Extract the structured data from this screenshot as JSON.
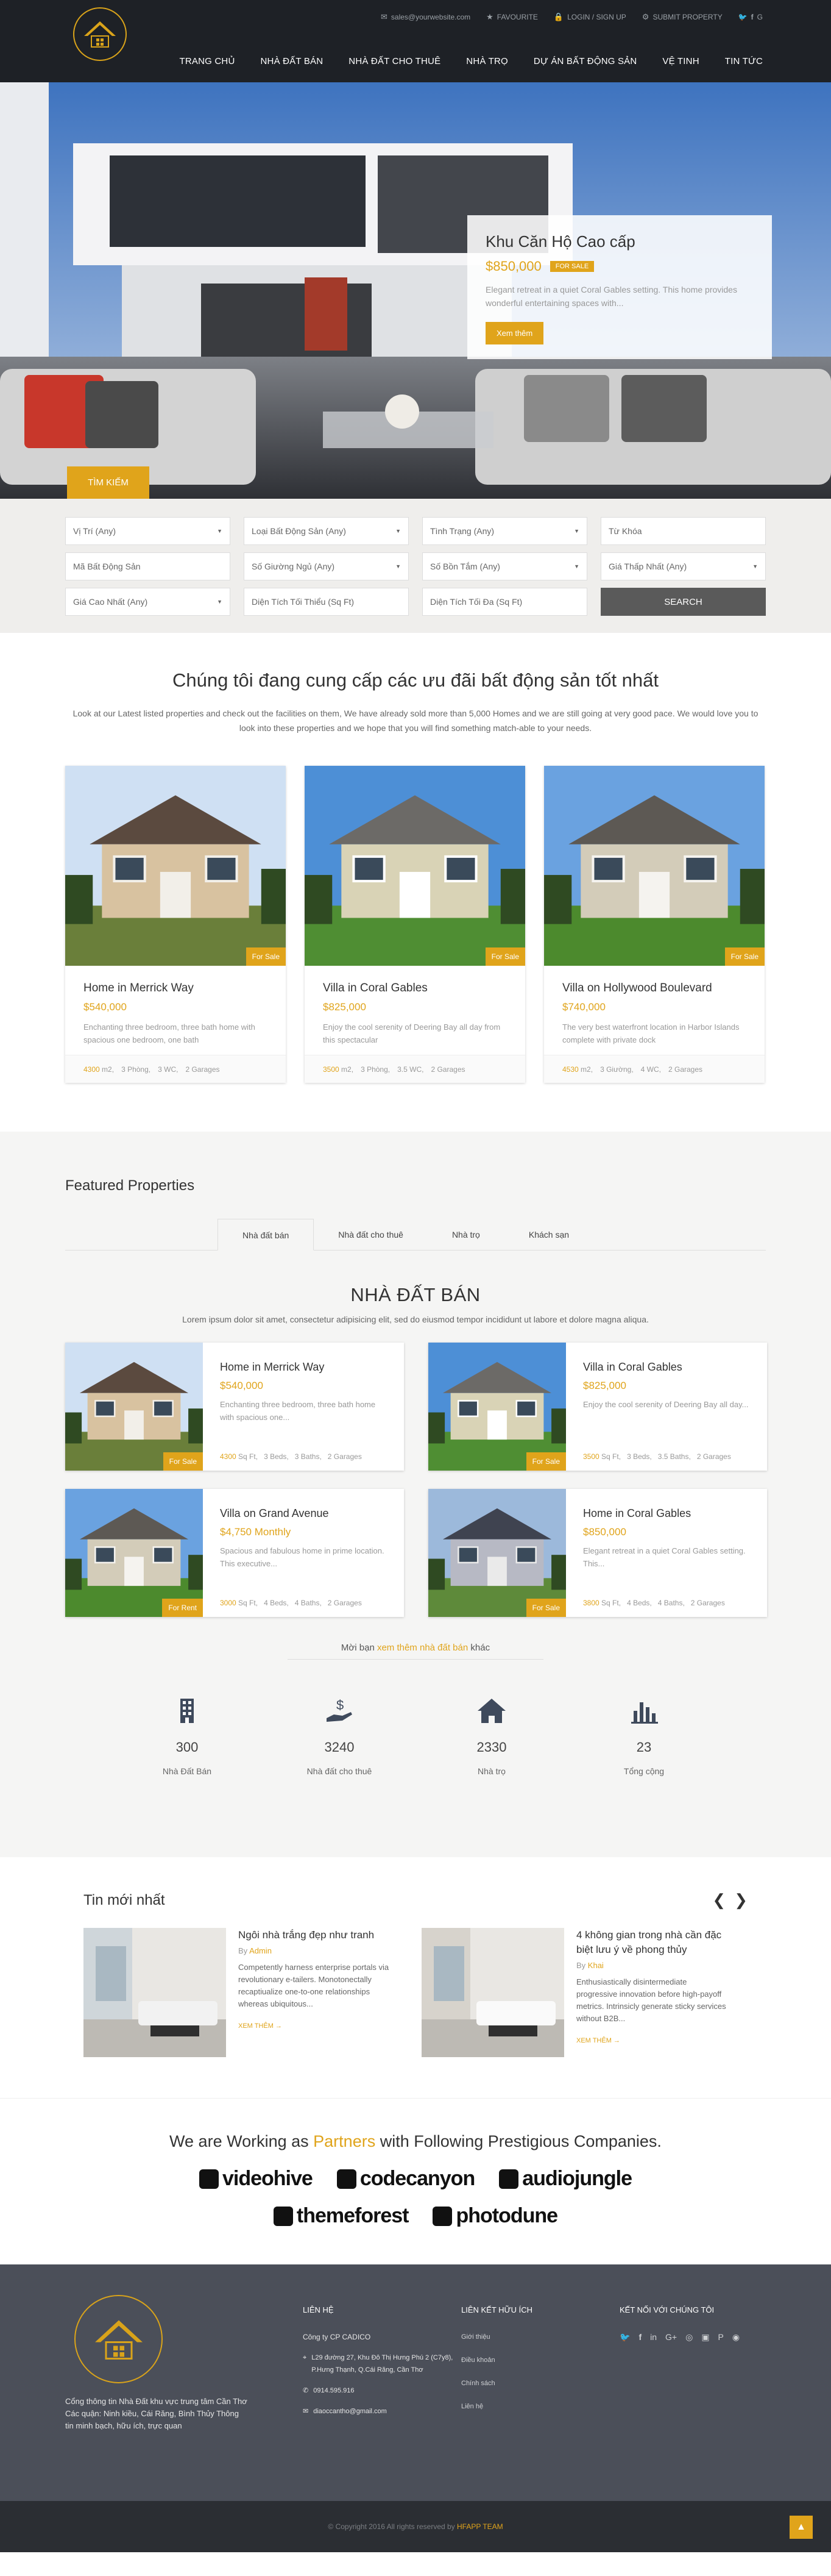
{
  "header": {
    "email": "sales@yourwebsite.com",
    "favourites": "FAVOURITE",
    "login": "LOGIN / SIGN UP",
    "submit": "SUBMIT PROPERTY",
    "nav": [
      "TRANG CHỦ",
      "NHÀ ĐẤT BÁN",
      "NHÀ ĐẤT CHO THUÊ",
      "NHÀ TRỌ",
      "DỰ ÁN BẤT ĐỘNG SẢN",
      "VỆ TINH",
      "TIN TỨC"
    ]
  },
  "hero": {
    "title": "Khu Căn Hộ Cao cấp",
    "price": "$850,000",
    "badge": "FOR SALE",
    "desc": "Elegant retreat in a quiet Coral Gables setting. This home provides wonderful entertaining spaces with...",
    "button": "Xem thêm",
    "search_tab": "TÌM KIẾM"
  },
  "search": {
    "fields": [
      {
        "label": "Vị Trí (Any)",
        "caret": true
      },
      {
        "label": "Loại Bất Động Sản (Any)",
        "caret": true
      },
      {
        "label": "Tình Trạng (Any)",
        "caret": true
      },
      {
        "label": "Từ Khóa",
        "caret": false
      },
      {
        "label": "Mã Bất Động Sản",
        "caret": false
      },
      {
        "label": "Số Giường Ngủ (Any)",
        "caret": true
      },
      {
        "label": "Số Bồn Tắm (Any)",
        "caret": true
      },
      {
        "label": "Giá Thấp Nhất (Any)",
        "caret": true
      },
      {
        "label": "Giá Cao Nhất (Any)",
        "caret": true
      },
      {
        "label": "Diện Tích Tối Thiểu (Sq Ft)",
        "caret": false
      },
      {
        "label": "Diện Tích Tối Đa (Sq Ft)",
        "caret": false
      }
    ],
    "button": "SEARCH"
  },
  "intro": {
    "title": "Chúng tôi đang cung cấp các ưu đãi bất động sản tốt nhất",
    "text": "Look at our Latest listed properties and check out the facilities on them, We have already sold more than 5,000 Homes and we are still going at very good pace. We would love you to look into these properties and we hope that you will find something match-able to your needs."
  },
  "listings": [
    {
      "title": "Home in Merrick Way",
      "price": "$540,000",
      "desc": "Enchanting three bedroom, three bath home with spacious one bedroom, one bath",
      "badge": "For Sale",
      "area": "4300",
      "unit": "m2,",
      "beds": "3 Phòng,",
      "baths": "3 WC,",
      "garages": "2 Garages"
    },
    {
      "title": "Villa in Coral Gables",
      "price": "$825,000",
      "desc": "Enjoy the cool serenity of Deering Bay all day from this spectacular",
      "badge": "For Sale",
      "area": "3500",
      "unit": "m2,",
      "beds": "3 Phòng,",
      "baths": "3.5 WC,",
      "garages": "2 Garages"
    },
    {
      "title": "Villa on Hollywood Boulevard",
      "price": "$740,000",
      "desc": "The very best waterfront location in Harbor Islands complete with private dock",
      "badge": "For Sale",
      "area": "4530",
      "unit": "m2,",
      "beds": "3 Giường,",
      "baths": "4 WC,",
      "garages": "2 Garages"
    }
  ],
  "featured": {
    "heading": "Featured Properties",
    "tabs": [
      "Nhà đất bán",
      "Nhà đất cho thuê",
      "Nhà trọ",
      "Khách sạn"
    ],
    "section_title": "NHÀ ĐẤT BÁN",
    "section_sub": "Lorem ipsum dolor sit amet, consectetur adipisicing elit, sed do eiusmod tempor incididunt ut labore et dolore magna aliqua.",
    "items": [
      {
        "title": "Home in Merrick Way",
        "price": "$540,000",
        "desc": "Enchanting three bedroom, three bath home with spacious one...",
        "badge": "For Sale",
        "area": "4300",
        "unit": "Sq Ft,",
        "beds": "3 Beds,",
        "baths": "3 Baths,",
        "garages": "2 Garages"
      },
      {
        "title": "Villa in Coral Gables",
        "price": "$825,000",
        "desc": "Enjoy the cool serenity of Deering Bay all day...",
        "badge": "For Sale",
        "area": "3500",
        "unit": "Sq Ft,",
        "beds": "3 Beds,",
        "baths": "3.5 Baths,",
        "garages": "2 Garages"
      },
      {
        "title": "Villa on Grand Avenue",
        "price": "$4,750 Monthly",
        "desc": "Spacious and fabulous home in prime location. This executive...",
        "badge": "For Rent",
        "area": "3000",
        "unit": "Sq Ft,",
        "beds": "4 Beds,",
        "baths": "4 Baths,",
        "garages": "2 Garages"
      },
      {
        "title": "Home in Coral Gables",
        "price": "$850,000",
        "desc": "Elegant retreat in a quiet Coral Gables setting. This...",
        "badge": "For Sale",
        "area": "3800",
        "unit": "Sq Ft,",
        "beds": "4 Beds,",
        "baths": "4 Baths,",
        "garages": "2 Garages"
      }
    ],
    "more_prefix": "Mời bạn",
    "more_link": "xem thêm nhà đất bán",
    "more_suffix": "khác"
  },
  "stats": [
    {
      "icon": "building-icon",
      "num": "300",
      "label": "Nhà Đất Bán"
    },
    {
      "icon": "money-hand-icon",
      "num": "3240",
      "label": "Nhà đất cho thuê"
    },
    {
      "icon": "home-icon",
      "num": "2330",
      "label": "Nhà trọ"
    },
    {
      "icon": "bar-chart-icon",
      "num": "23",
      "label": "Tổng cộng"
    }
  ],
  "news": {
    "title": "Tin mới nhất",
    "items": [
      {
        "title": "Ngôi nhà trắng đẹp như tranh",
        "by": "By",
        "author": "Admin",
        "desc": "Competently harness enterprise portals via revolutionary e-tailers. Monotonectally recaptiualize one-to-one relationships whereas ubiquitous...",
        "more": "XEM THÊM →"
      },
      {
        "title": "4 không gian trong nhà cần đặc biệt lưu ý về phong thủy",
        "by": "By",
        "author": "Khai",
        "desc": "Enthusiastically disintermediate progressive innovation before high-payoff metrics. Intrinsicly generate sticky services without B2B...",
        "more": "XEM THÊM →"
      }
    ]
  },
  "partners": {
    "prefix": "We are Working as",
    "highlight": "Partners",
    "suffix": "with Following Prestigious Companies.",
    "logos": [
      "videohive",
      "codecanyon",
      "audiojungle",
      "themeforest",
      "photodune"
    ]
  },
  "footer": {
    "about": "Cổng thông tin Nhà Đất khu vực trung tâm Cần Thơ Các quận: Ninh kiều, Cái Răng, Bình Thủy Thông tin minh bạch, hữu ích, trực quan",
    "contact_title": "LIÊN HỆ",
    "company": "Công ty CP CADICO",
    "address": "L29 đường 27, Khu Đô Thị Hưng Phú 2 (C7y8), P.Hưng Thạnh, Q.Cái Răng, Cần Thơ",
    "phone": "0914.595.916",
    "email": "diaoccantho@gmail.com",
    "links_title": "LIÊN KẾT HỮU ÍCH",
    "links": [
      "Giới thiệu",
      "Điều khoản",
      "Chính sách",
      "Liên hệ"
    ],
    "social_title": "KẾT NỐI VỚI CHÚNG TÔI",
    "copyright": "© Copyright 2016 All rights reserved by",
    "brand": "HFAPP TEAM"
  }
}
